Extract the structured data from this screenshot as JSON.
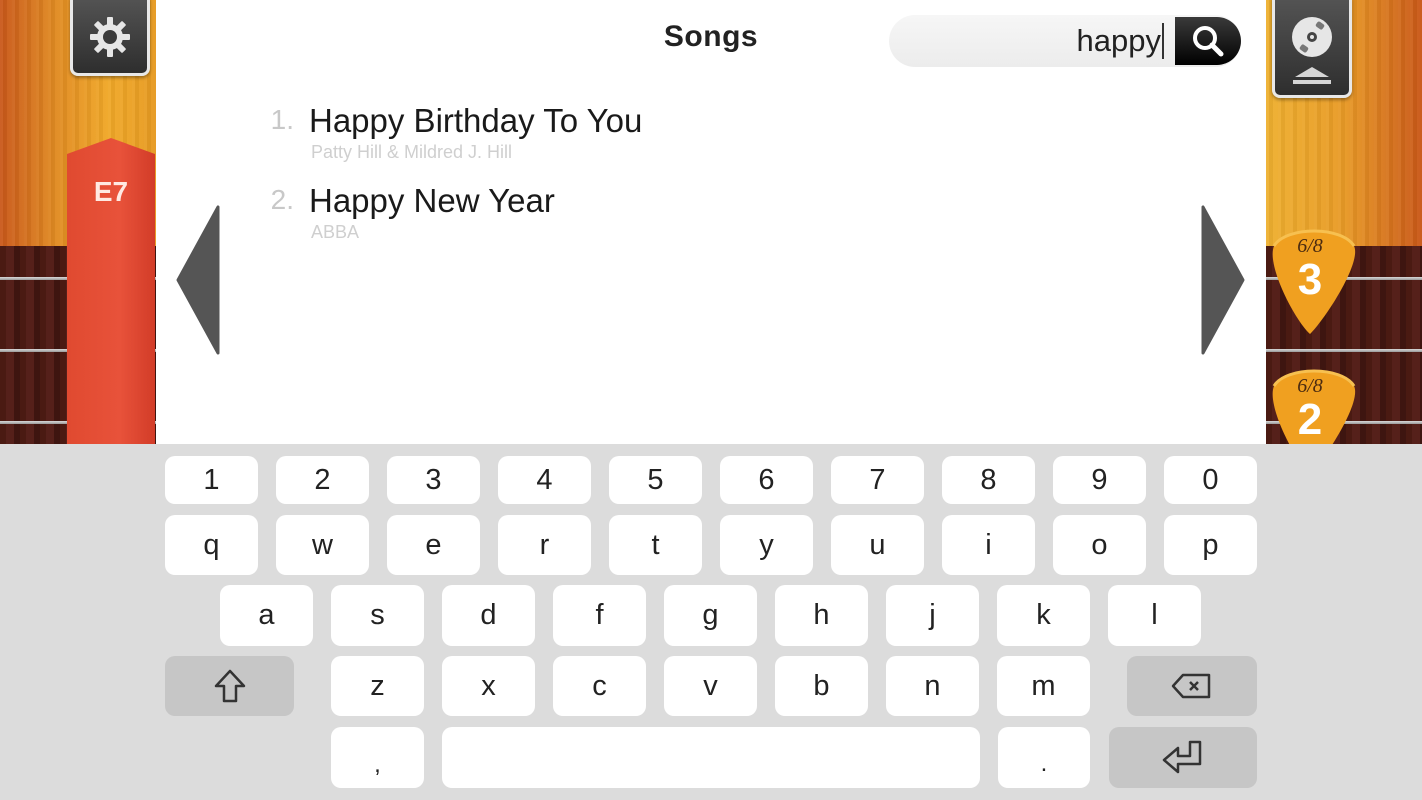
{
  "left_panel": {
    "settings_icon": "gear-icon",
    "chord_label": "E7"
  },
  "right_panel": {
    "songs_icon": "disc-eject-icon",
    "picks": [
      {
        "time_signature": "6/8",
        "count": "3"
      },
      {
        "time_signature": "6/8",
        "count": "2"
      }
    ]
  },
  "header": {
    "title": "Songs"
  },
  "search": {
    "value": "happy",
    "button_icon": "search-icon"
  },
  "songs": [
    {
      "number": "1.",
      "title": "Happy Birthday To You",
      "artist": "Patty Hill & Mildred J. Hill"
    },
    {
      "number": "2.",
      "title": "Happy New Year",
      "artist": "ABBA"
    }
  ],
  "navigation": {
    "prev_icon": "triangle-left-icon",
    "next_icon": "triangle-right-icon"
  },
  "keyboard": {
    "row1": [
      "1",
      "2",
      "3",
      "4",
      "5",
      "6",
      "7",
      "8",
      "9",
      "0"
    ],
    "row2": [
      "q",
      "w",
      "e",
      "r",
      "t",
      "y",
      "u",
      "i",
      "o",
      "p"
    ],
    "row3": [
      "a",
      "s",
      "d",
      "f",
      "g",
      "h",
      "j",
      "k",
      "l"
    ],
    "row4": [
      "z",
      "x",
      "c",
      "v",
      "b",
      "n",
      "m"
    ],
    "comma": ",",
    "period": ".",
    "space": "",
    "shift_icon": "shift-arrow-icon",
    "backspace_icon": "backspace-icon",
    "enter_icon": "enter-icon"
  },
  "colors": {
    "chord_tab": "#e04a30",
    "pick": "#f0a020",
    "fretboard": "#4a1a12",
    "keyboard_bg": "#dcdcdc",
    "function_key": "#c6c6c6"
  }
}
